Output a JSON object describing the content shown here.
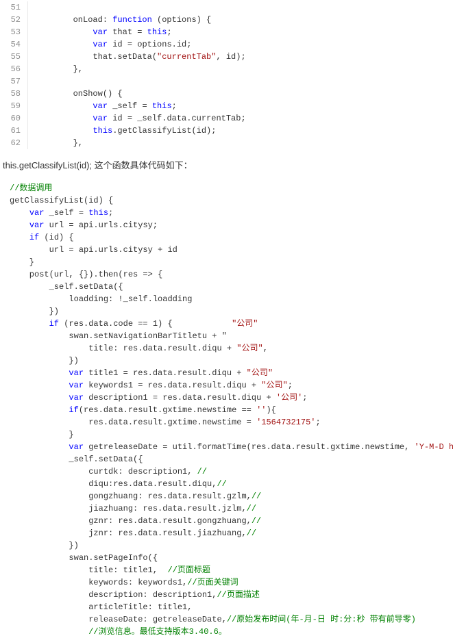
{
  "block1": {
    "gutter": [
      "51",
      "52",
      "53",
      "54",
      "55",
      "56",
      "57",
      "58",
      "59",
      "60",
      "61",
      "62"
    ],
    "lines": [
      [
        {
          "t": "",
          "c": "txt"
        }
      ],
      [
        {
          "t": "        onLoad: ",
          "c": "txt"
        },
        {
          "t": "function",
          "c": "kw"
        },
        {
          "t": " (options) {",
          "c": "txt"
        }
      ],
      [
        {
          "t": "            ",
          "c": "txt"
        },
        {
          "t": "var",
          "c": "kw"
        },
        {
          "t": " that = ",
          "c": "txt"
        },
        {
          "t": "this",
          "c": "kw"
        },
        {
          "t": ";",
          "c": "txt"
        }
      ],
      [
        {
          "t": "            ",
          "c": "txt"
        },
        {
          "t": "var",
          "c": "kw"
        },
        {
          "t": " id = options.id;",
          "c": "txt"
        }
      ],
      [
        {
          "t": "            that.setData(",
          "c": "txt"
        },
        {
          "t": "\"currentTab\"",
          "c": "str"
        },
        {
          "t": ", id);",
          "c": "txt"
        }
      ],
      [
        {
          "t": "        },",
          "c": "txt"
        }
      ],
      [
        {
          "t": "",
          "c": "txt"
        }
      ],
      [
        {
          "t": "        onShow() {",
          "c": "txt"
        }
      ],
      [
        {
          "t": "            ",
          "c": "txt"
        },
        {
          "t": "var",
          "c": "kw"
        },
        {
          "t": " _self = ",
          "c": "txt"
        },
        {
          "t": "this",
          "c": "kw"
        },
        {
          "t": ";",
          "c": "txt"
        }
      ],
      [
        {
          "t": "            ",
          "c": "txt"
        },
        {
          "t": "var",
          "c": "kw"
        },
        {
          "t": " id = _self.data.currentTab;",
          "c": "txt"
        }
      ],
      [
        {
          "t": "            ",
          "c": "txt"
        },
        {
          "t": "this",
          "c": "kw"
        },
        {
          "t": ".getClassifyList(id);",
          "c": "txt"
        }
      ],
      [
        {
          "t": "        },",
          "c": "txt"
        }
      ]
    ]
  },
  "intertext": "this.getClassifyList(id); 这个函数具体代码如下：",
  "block2": {
    "lines": [
      [
        {
          "t": "//数据调用",
          "c": "comment-green"
        }
      ],
      [
        {
          "t": "getClassifyList(id) {",
          "c": "txt"
        }
      ],
      [
        {
          "t": "    ",
          "c": "txt"
        },
        {
          "t": "var",
          "c": "kw"
        },
        {
          "t": " _self = ",
          "c": "txt"
        },
        {
          "t": "this",
          "c": "kw"
        },
        {
          "t": ";",
          "c": "txt"
        }
      ],
      [
        {
          "t": "    ",
          "c": "txt"
        },
        {
          "t": "var",
          "c": "kw"
        },
        {
          "t": " url = api.urls.citysy;",
          "c": "txt"
        }
      ],
      [
        {
          "t": "    ",
          "c": "txt"
        },
        {
          "t": "if",
          "c": "kw"
        },
        {
          "t": " (id) {",
          "c": "txt"
        }
      ],
      [
        {
          "t": "        url = api.urls.citysy + id",
          "c": "txt"
        }
      ],
      [
        {
          "t": "    }",
          "c": "txt"
        }
      ],
      [
        {
          "t": "    post(url, {}).then(res => {",
          "c": "txt"
        }
      ],
      [
        {
          "t": "        _self.setData({",
          "c": "txt"
        }
      ],
      [
        {
          "t": "            loadding: !_self.loadding",
          "c": "txt"
        }
      ],
      [
        {
          "t": "        })",
          "c": "txt"
        }
      ],
      [
        {
          "t": "        ",
          "c": "txt"
        },
        {
          "t": "if",
          "c": "kw"
        },
        {
          "t": " (res.data.code == 1) {            ",
          "c": "txt"
        },
        {
          "t": "\"公司\"",
          "c": "str"
        }
      ],
      [
        {
          "t": "            swan.setNavigationBarTitletu + \"",
          "c": "txt"
        }
      ],
      [
        {
          "t": "                title: res.data.result.diqu + ",
          "c": "txt"
        },
        {
          "t": "\"公司\"",
          "c": "str"
        },
        {
          "t": ",",
          "c": "txt"
        }
      ],
      [
        {
          "t": "            })",
          "c": "txt"
        }
      ],
      [
        {
          "t": "            ",
          "c": "txt"
        },
        {
          "t": "var",
          "c": "kw"
        },
        {
          "t": " title1 = res.data.result.diqu + ",
          "c": "txt"
        },
        {
          "t": "\"公司\"",
          "c": "str"
        }
      ],
      [
        {
          "t": "            ",
          "c": "txt"
        },
        {
          "t": "var",
          "c": "kw"
        },
        {
          "t": " keywords1 = res.data.result.diqu + ",
          "c": "txt"
        },
        {
          "t": "\"公司\"",
          "c": "str"
        },
        {
          "t": ";",
          "c": "txt"
        }
      ],
      [
        {
          "t": "            ",
          "c": "txt"
        },
        {
          "t": "var",
          "c": "kw"
        },
        {
          "t": " description1 = res.data.result.diqu + ",
          "c": "txt"
        },
        {
          "t": "'公司'",
          "c": "str"
        },
        {
          "t": ";",
          "c": "txt"
        }
      ],
      [
        {
          "t": "            ",
          "c": "txt"
        },
        {
          "t": "if",
          "c": "kw"
        },
        {
          "t": "(res.data.result.gxtime.newstime == ",
          "c": "txt"
        },
        {
          "t": "''",
          "c": "str"
        },
        {
          "t": "){",
          "c": "txt"
        }
      ],
      [
        {
          "t": "                res.data.result.gxtime.newstime = ",
          "c": "txt"
        },
        {
          "t": "'1564732175'",
          "c": "str"
        },
        {
          "t": ";",
          "c": "txt"
        }
      ],
      [
        {
          "t": "            }",
          "c": "txt"
        }
      ],
      [
        {
          "t": "            ",
          "c": "txt"
        },
        {
          "t": "var",
          "c": "kw"
        },
        {
          "t": " getreleaseDate = util.formatTime(res.data.result.gxtime.newstime, ",
          "c": "txt"
        },
        {
          "t": "'Y-M-D h:m:s'",
          "c": "str"
        },
        {
          "t": ");",
          "c": "txt"
        }
      ],
      [
        {
          "t": "            _self.setData({",
          "c": "txt"
        }
      ],
      [
        {
          "t": "                curtdk: description1, ",
          "c": "txt"
        },
        {
          "t": "//",
          "c": "comment-green"
        }
      ],
      [
        {
          "t": "                diqu:res.data.result.diqu,",
          "c": "txt"
        },
        {
          "t": "//",
          "c": "comment-green"
        }
      ],
      [
        {
          "t": "                gongzhuang: res.data.result.gzlm,",
          "c": "txt"
        },
        {
          "t": "//",
          "c": "comment-green"
        }
      ],
      [
        {
          "t": "                jiazhuang: res.data.result.jzlm,",
          "c": "txt"
        },
        {
          "t": "//",
          "c": "comment-green"
        }
      ],
      [
        {
          "t": "                gznr: res.data.result.gongzhuang,",
          "c": "txt"
        },
        {
          "t": "//",
          "c": "comment-green"
        }
      ],
      [
        {
          "t": "                jznr: res.data.result.jiazhuang,",
          "c": "txt"
        },
        {
          "t": "//",
          "c": "comment-green"
        }
      ],
      [
        {
          "t": "            })",
          "c": "txt"
        }
      ],
      [
        {
          "t": "            swan.setPageInfo({",
          "c": "txt"
        }
      ],
      [
        {
          "t": "                title: title1,  ",
          "c": "txt"
        },
        {
          "t": "//页面标题",
          "c": "comment-green"
        }
      ],
      [
        {
          "t": "                keywords: keywords1,",
          "c": "txt"
        },
        {
          "t": "//页面关键词",
          "c": "comment-green"
        }
      ],
      [
        {
          "t": "                description: description1,",
          "c": "txt"
        },
        {
          "t": "//页面描述",
          "c": "comment-green"
        }
      ],
      [
        {
          "t": "                articleTitle: title1,",
          "c": "txt"
        }
      ],
      [
        {
          "t": "                releaseDate: getreleaseDate,",
          "c": "txt"
        },
        {
          "t": "//原始发布时间(年-月-日 时:分:秒 带有前导零)",
          "c": "comment-green"
        }
      ],
      [
        {
          "t": "                ",
          "c": "txt"
        },
        {
          "t": "//浏览信息。最低支持版本3.40.6。",
          "c": "comment-green"
        }
      ]
    ]
  }
}
